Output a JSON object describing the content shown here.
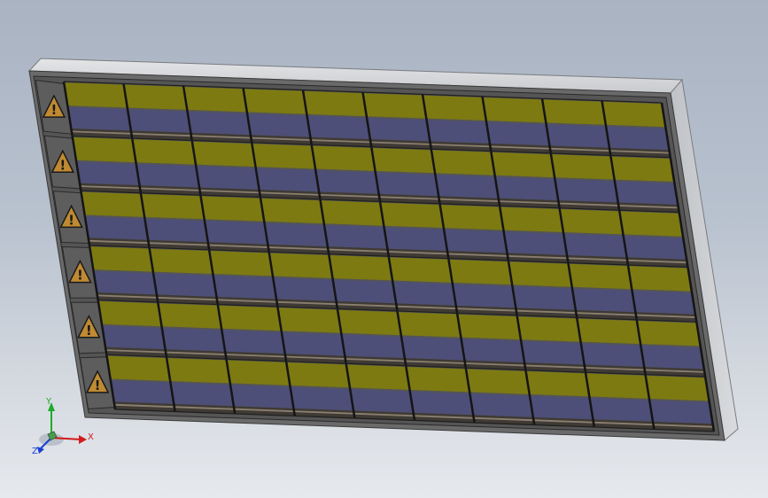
{
  "view": {
    "background_top": "#a9b3c2",
    "background_bottom": "#e6e9ed"
  },
  "model": {
    "name": "solar-panel",
    "rows": 6,
    "columns": 10,
    "warning_icon": "warning-triangle-icon",
    "colors": {
      "frame_top": "#d4d6d9",
      "frame_side": "#c2c5c9",
      "frame_face": "#6f6f6f",
      "cell_yellow": "#7d7a12",
      "cell_blue": "#4d4f78",
      "grid_line": "#151515",
      "warning_fill": "#c08a32"
    }
  },
  "triad": {
    "x_label": "X",
    "y_label": "Y",
    "z_label": "Z",
    "x_color": "#d21a1a",
    "y_color": "#1eaa2a",
    "z_color": "#1a3fd2"
  }
}
